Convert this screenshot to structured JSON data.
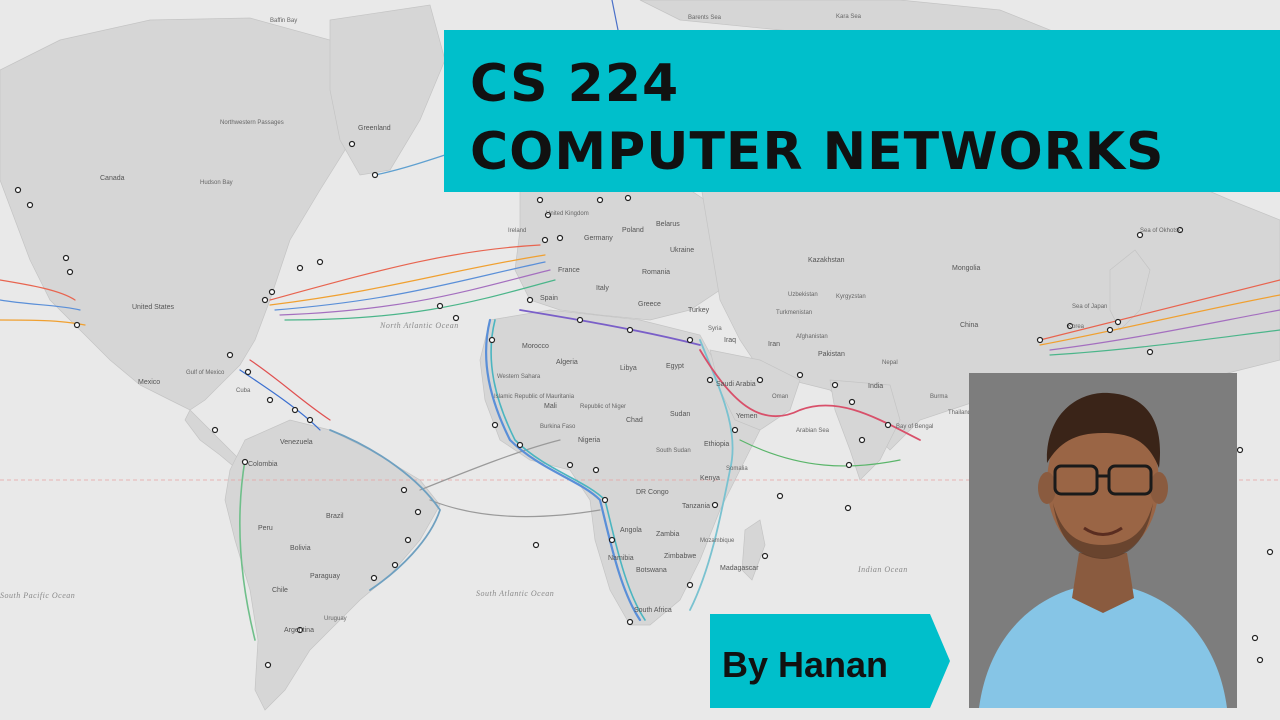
{
  "title": {
    "line1": "CS 224",
    "line2": "COMPUTER NETWORKS"
  },
  "byline": "By Hanan",
  "colors": {
    "accent": "#00bfcb",
    "land": "#d6d6d6",
    "sea": "#e9e9e9",
    "photo_bg": "#7d7d7d",
    "shirt": "#86c5e6"
  },
  "map_labels": {
    "baffin_bay": "Baffin Bay",
    "barents_sea": "Barents Sea",
    "kara_sea": "Kara Sea",
    "greenland": "Greenland",
    "northwestern_passages": "Northwestern Passages",
    "canada": "Canada",
    "hudson_bay": "Hudson Bay",
    "united_states": "United States",
    "mexico": "Mexico",
    "gulf_of_mexico": "Gulf of Mexico",
    "cuba": "Cuba",
    "colombia": "Colombia",
    "venezuela": "Venezuela",
    "brazil": "Brazil",
    "peru": "Peru",
    "bolivia": "Bolivia",
    "paraguay": "Paraguay",
    "chile": "Chile",
    "argentina": "Argentina",
    "uruguay": "Uruguay",
    "north_atlantic_ocean": "North Atlantic Ocean",
    "south_atlantic_ocean": "South Atlantic Ocean",
    "south_pacific_ocean": "South Pacific Ocean",
    "indian_ocean": "Indian Ocean",
    "spain": "Spain",
    "france": "France",
    "germany": "Germany",
    "poland": "Poland",
    "belarus": "Belarus",
    "ukraine": "Ukraine",
    "romania": "Romania",
    "italy": "Italy",
    "greece": "Greece",
    "turkey": "Turkey",
    "ireland": "Ireland",
    "united_kingdom": "United Kingdom",
    "morocco": "Morocco",
    "algeria": "Algeria",
    "libya": "Libya",
    "egypt": "Egypt",
    "mali": "Mali",
    "niger": "Republic of Niger",
    "mauritania": "Islamic Republic of Mauritania",
    "western_sahara": "Western Sahara",
    "chad": "Chad",
    "sudan": "Sudan",
    "south_sudan": "South Sudan",
    "ethiopia": "Ethiopia",
    "nigeria": "Nigeria",
    "burkina_faso": "Burkina Faso",
    "dr_congo": "DR Congo",
    "kenya": "Kenya",
    "somalia": "Somalia",
    "tanzania": "Tanzania",
    "angola": "Angola",
    "zambia": "Zambia",
    "zimbabwe": "Zimbabwe",
    "mozambique": "Mozambique",
    "namibia": "Namibia",
    "botswana": "Botswana",
    "madagascar": "Madagascar",
    "south_africa": "South Africa",
    "saudi_arabia": "Saudi Arabia",
    "yemen": "Yemen",
    "oman": "Oman",
    "iran": "Iran",
    "iraq": "Iraq",
    "syria": "Syria",
    "afghanistan": "Afghanistan",
    "pakistan": "Pakistan",
    "india": "India",
    "arabian_sea": "Arabian Sea",
    "bay_of_bengal": "Bay of Bengal",
    "kazakhstan": "Kazakhstan",
    "uzbekistan": "Uzbekistan",
    "turkmenistan": "Turkmenistan",
    "kyrgyzstan": "Kyrgyzstan",
    "mongolia": "Mongolia",
    "china": "China",
    "nepal": "Nepal",
    "burma": "Burma",
    "thailand": "Thailand",
    "sea_of_japan": "Sea of Japan",
    "sea_of_okhotsk": "Sea of Okhotsk",
    "korea": "Korea"
  },
  "icons": {
    "landing_point": "landing-point-icon",
    "corner_notch": "corner-notch-icon"
  }
}
